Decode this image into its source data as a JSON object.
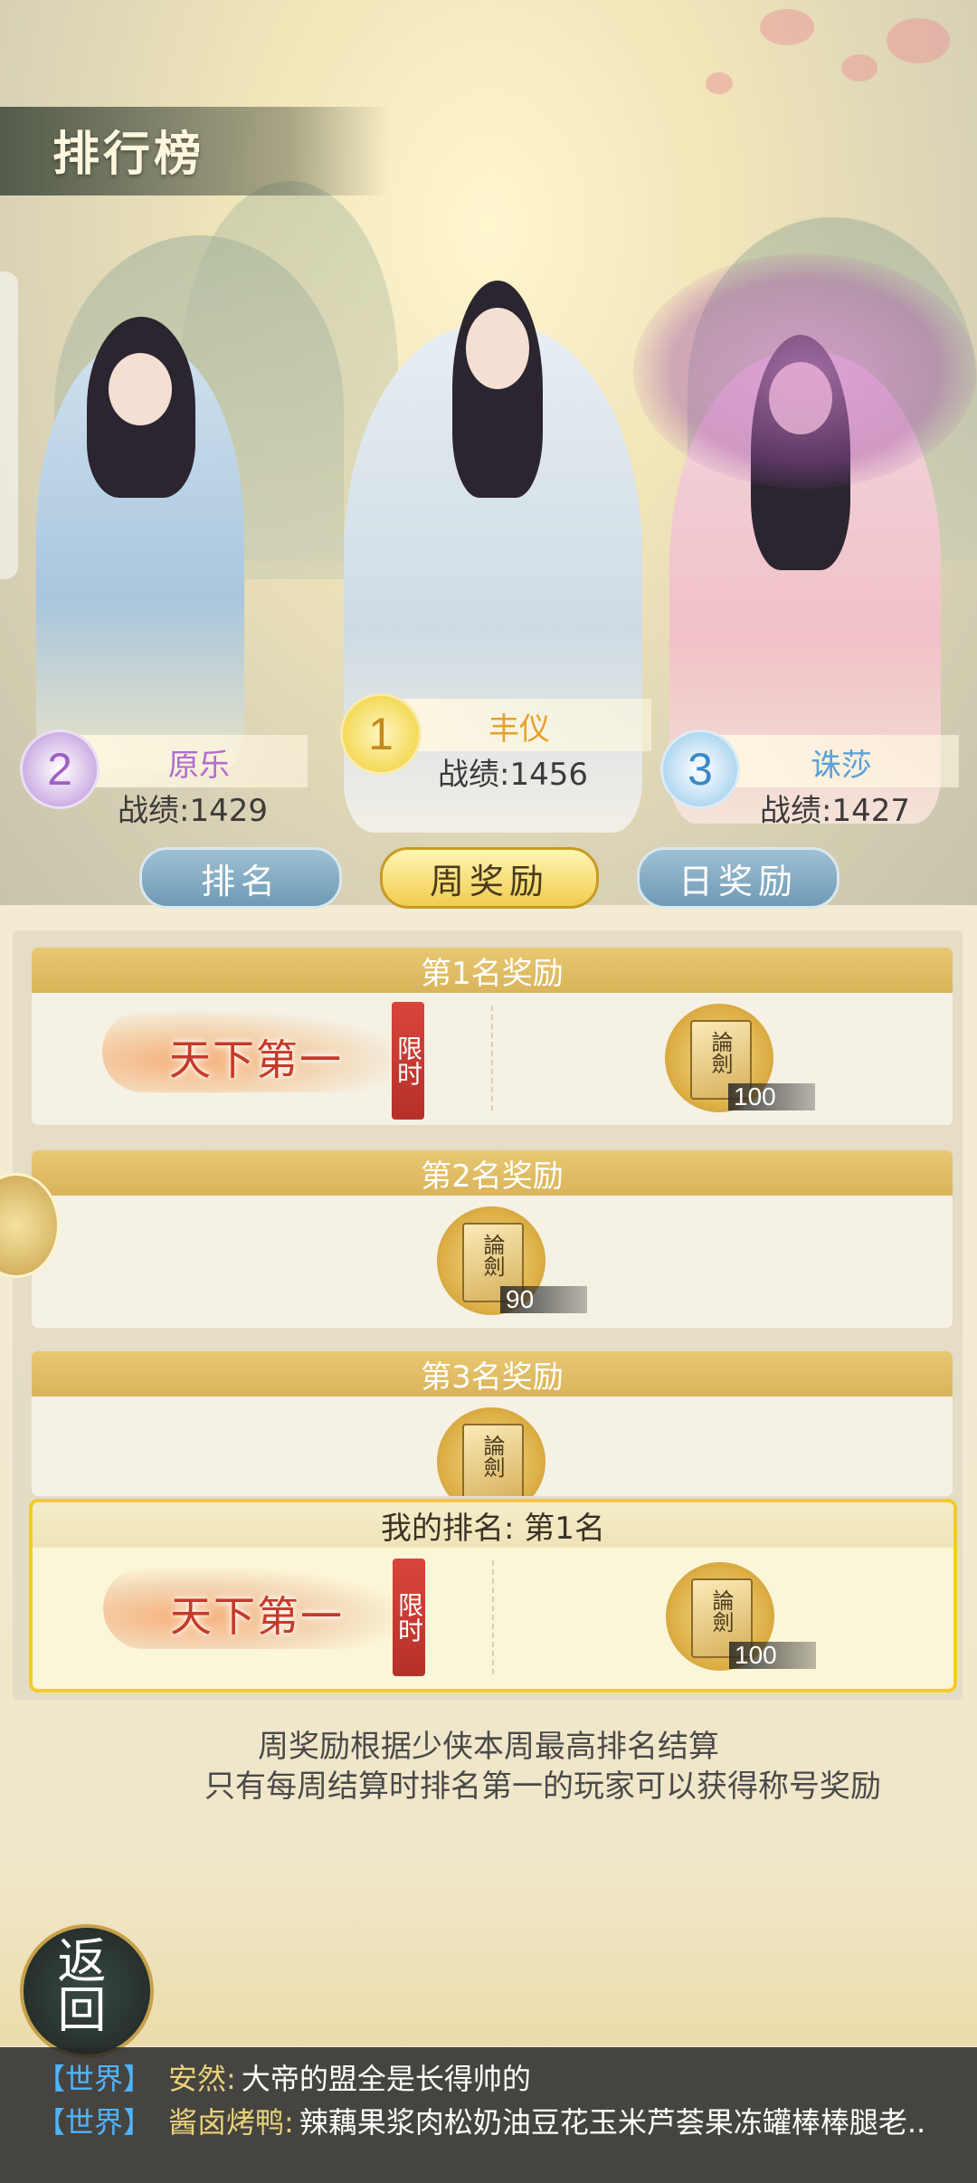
{
  "header": {
    "title": "排行榜"
  },
  "podium": [
    {
      "rank": "1",
      "name": "丰仪",
      "score_label": "战绩:1456",
      "name_color": "#e5a12d",
      "badge_color": "#f2d64a"
    },
    {
      "rank": "2",
      "name": "原乐",
      "score_label": "战绩:1429",
      "name_color": "#b26bd1",
      "badge_color": "#c7a5e0"
    },
    {
      "rank": "3",
      "name": "诛莎",
      "score_label": "战绩:1427",
      "name_color": "#5a9fd6",
      "badge_color": "#a7d3ef"
    }
  ],
  "tabs": [
    {
      "label": "排名",
      "active": false
    },
    {
      "label": "周奖励",
      "active": true
    },
    {
      "label": "日奖励",
      "active": false
    }
  ],
  "rewards": [
    {
      "header": "第1名奖励",
      "title_badge": {
        "text": "天下第一",
        "tag": "限时"
      },
      "item": {
        "icon": "lunjian-book-icon",
        "text": "論劍",
        "count": "100"
      }
    },
    {
      "header": "第2名奖励",
      "item": {
        "icon": "lunjian-book-icon",
        "text": "論劍",
        "count": "90"
      }
    },
    {
      "header": "第3名奖励",
      "item": {
        "icon": "lunjian-book-icon",
        "text": "論劍",
        "count": ""
      }
    }
  ],
  "my_rank": {
    "header": "我的排名: 第1名",
    "title_badge": {
      "text": "天下第一",
      "tag": "限时"
    },
    "item": {
      "icon": "lunjian-book-icon",
      "text": "論劍",
      "count": "100"
    }
  },
  "notes": [
    "周奖励根据少侠本周最高排名结算",
    "只有每周结算时排名第一的玩家可以获得称号奖励"
  ],
  "back_button": {
    "label": "返回"
  },
  "chat": [
    {
      "channel": "【世界】",
      "user": "安然:",
      "message": "大帝的盟全是长得帅的"
    },
    {
      "channel": "【世界】",
      "user": "酱卤烤鸭:",
      "message": "辣藕果浆肉松奶油豆花玉米芦荟果冻罐棒棒腿老.."
    }
  ]
}
